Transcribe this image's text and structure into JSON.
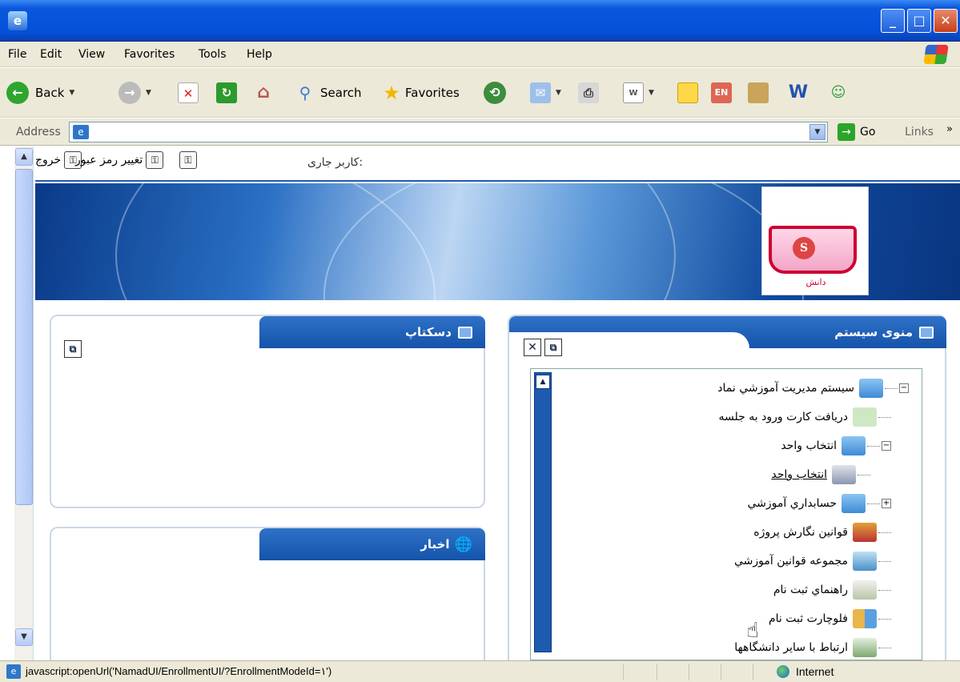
{
  "window": {
    "minimize": "_",
    "maximize": "□",
    "close": "✕"
  },
  "menubar": [
    "File",
    "Edit",
    "View",
    "Favorites",
    "Tools",
    "Help"
  ],
  "toolbar": {
    "back": "Back",
    "search": "Search",
    "favorites": "Favorites"
  },
  "address": {
    "label": "Address",
    "go": "Go",
    "links": "Links",
    "chevron": "»"
  },
  "topbar": {
    "logout": "خروج",
    "change_password": "تغییر رمز عبور",
    "current_user_label": "کاربر جاری:"
  },
  "logo": {
    "text": "دانش"
  },
  "panels": {
    "desktop": {
      "title": "دسکتاپ"
    },
    "news": {
      "title": "اخبار"
    },
    "system_menu": {
      "title": "منوی سیستم"
    }
  },
  "tree": [
    {
      "label": "سيستم مديريت آموزشي نماد",
      "expander": "−",
      "icon": "folder-icon"
    },
    {
      "label": "دریافت کارت ورود به جلسه",
      "icon": "card-icon"
    },
    {
      "label": "انتخاب واحد",
      "expander": "−",
      "icon": "folder-icon"
    },
    {
      "label": "انتخاب واحد",
      "icon": "keyboard-icon"
    },
    {
      "label": "حسابداري آموزشي",
      "expander": "+",
      "icon": "folder-icon"
    },
    {
      "label": "قوانین نگارش پروژه",
      "icon": "book-icon"
    },
    {
      "label": "مجموعه قوانين آموزشي",
      "icon": "id-card-icon"
    },
    {
      "label": "راهنماي ثبت نام",
      "icon": "clipboard-icon"
    },
    {
      "label": "فلوچارت ثبت نام",
      "icon": "chart-icon"
    },
    {
      "label": "ارتباط با ساير دانشگاهها",
      "icon": "link-icon"
    }
  ],
  "status": {
    "text": "javascript:openUrl('NamadUI/EnrollmentUI/?EnrollmentModeId=۱')",
    "zone": "Internet"
  }
}
